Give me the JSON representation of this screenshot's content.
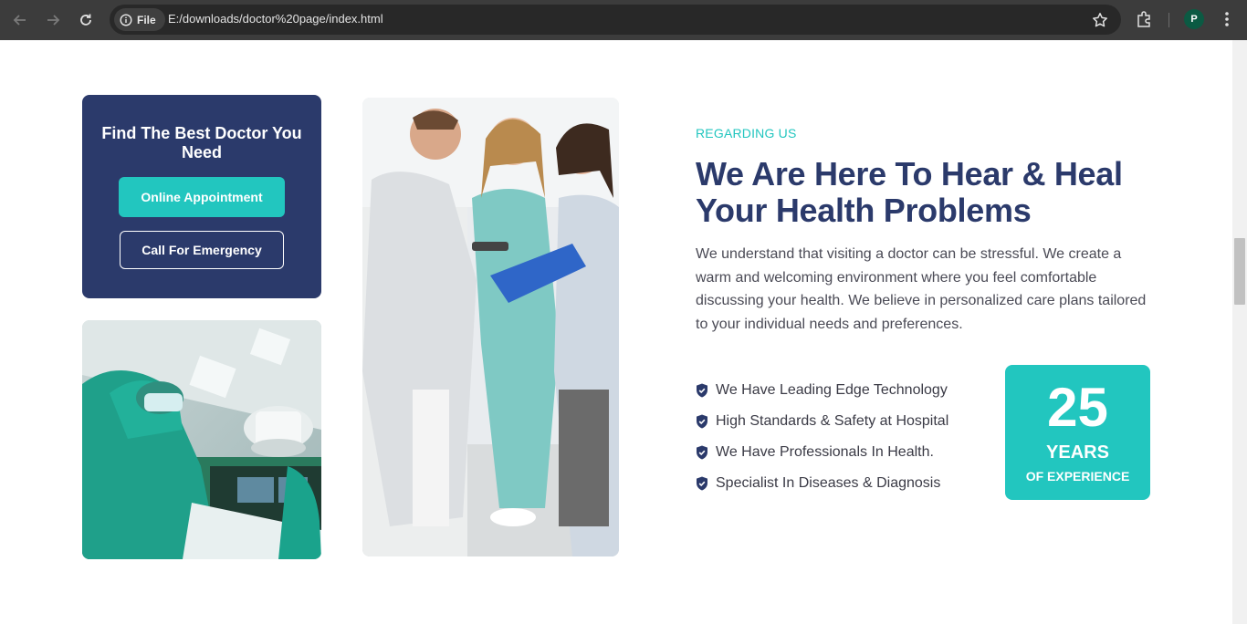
{
  "browser": {
    "file_chip_label": "File",
    "url": "E:/downloads/doctor%20page/index.html",
    "profile_initial": "P"
  },
  "find_card": {
    "title": "Find The Best Doctor You Need",
    "online_button": "Online Appointment",
    "emergency_button": "Call For Emergency"
  },
  "about": {
    "eyebrow": "REGARDING US",
    "heading": "We Are Here To Hear & Heal Your Health Problems",
    "paragraph": "We understand that visiting a doctor can be stressful. We create a warm and welcoming environment where you feel comfortable discussing your health. We believe in personalized care plans tailored to your individual needs and preferences.",
    "features": [
      "We Have Leading Edge Technology",
      "High Standards & Safety at Hospital",
      "We Have Professionals In Health.",
      "Specialist In Diseases & Diagnosis"
    ]
  },
  "experience": {
    "number": "25",
    "word": "YEARS",
    "sub": "OF EXPERIENCE"
  },
  "colors": {
    "navy": "#2b3a6b",
    "teal": "#22c6bf",
    "chrome": "#3c3c3c"
  },
  "icons": {
    "feature_bullet": "shield-check-icon",
    "back": "arrow-left-icon",
    "forward": "arrow-right-icon",
    "reload": "reload-icon",
    "info": "info-icon",
    "bookmark": "star-icon",
    "extensions": "puzzle-icon",
    "menu": "kebab-menu-icon"
  }
}
